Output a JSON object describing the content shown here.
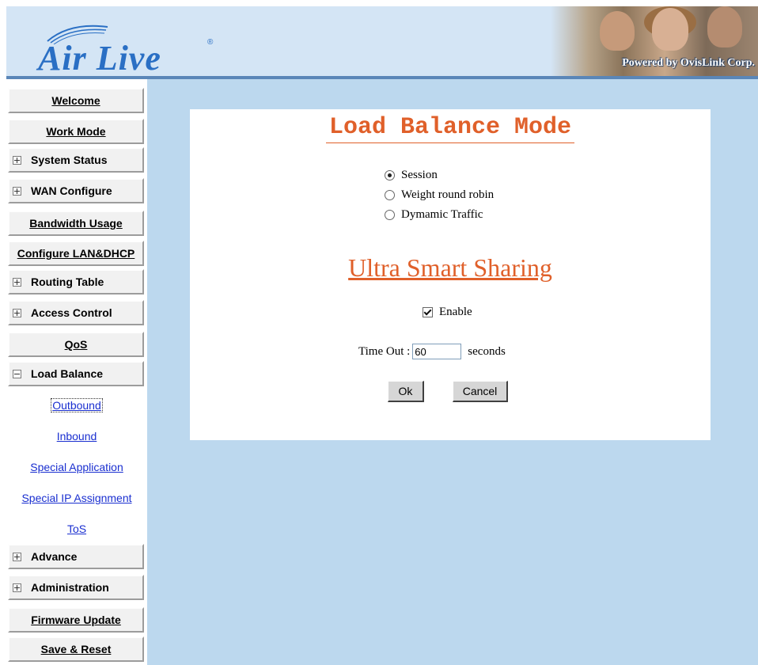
{
  "header": {
    "logo_text": "Air Live",
    "logo_registered": "®",
    "tagline": "Powered by OvisLink Corp."
  },
  "sidebar": {
    "items": [
      {
        "label": "Welcome",
        "expander": "none"
      },
      {
        "label": "Work Mode",
        "expander": "none"
      },
      {
        "label": "System Status",
        "expander": "plus"
      },
      {
        "label": "WAN Configure",
        "expander": "plus"
      },
      {
        "label": "Bandwidth Usage",
        "expander": "none"
      },
      {
        "label": "Configure LAN&DHCP",
        "expander": "none"
      },
      {
        "label": "Routing Table",
        "expander": "plus"
      },
      {
        "label": "Access Control",
        "expander": "plus"
      },
      {
        "label": "QoS",
        "expander": "none"
      },
      {
        "label": "Load Balance",
        "expander": "minus"
      },
      {
        "label": "Advance",
        "expander": "plus"
      },
      {
        "label": "Administration",
        "expander": "plus"
      },
      {
        "label": "Firmware Update",
        "expander": "none"
      },
      {
        "label": "Save & Reset",
        "expander": "none"
      }
    ],
    "load_balance_subitems": [
      {
        "label": "Outbound",
        "selected": true
      },
      {
        "label": "Inbound"
      },
      {
        "label": "Special Application"
      },
      {
        "label": "Special IP Assignment"
      },
      {
        "label": "ToS"
      }
    ]
  },
  "main": {
    "title": "Load Balance Mode",
    "modes": [
      {
        "label": "Session",
        "checked": true
      },
      {
        "label": "Weight round robin",
        "checked": false
      },
      {
        "label": "Dymamic Traffic",
        "checked": false
      }
    ],
    "uss_title": "Ultra Smart Sharing",
    "enable_label": "Enable",
    "enable_checked": true,
    "timeout_label": "Time Out :",
    "timeout_value": "60",
    "timeout_unit": "seconds",
    "ok_label": "Ok",
    "cancel_label": "Cancel"
  },
  "colors": {
    "accent_orange": "#e0602a",
    "main_bg": "#bcd8ee",
    "header_bg": "#d4e5f5",
    "link_blue": "#1a2fd0",
    "logo_blue": "#2a6fc4"
  }
}
